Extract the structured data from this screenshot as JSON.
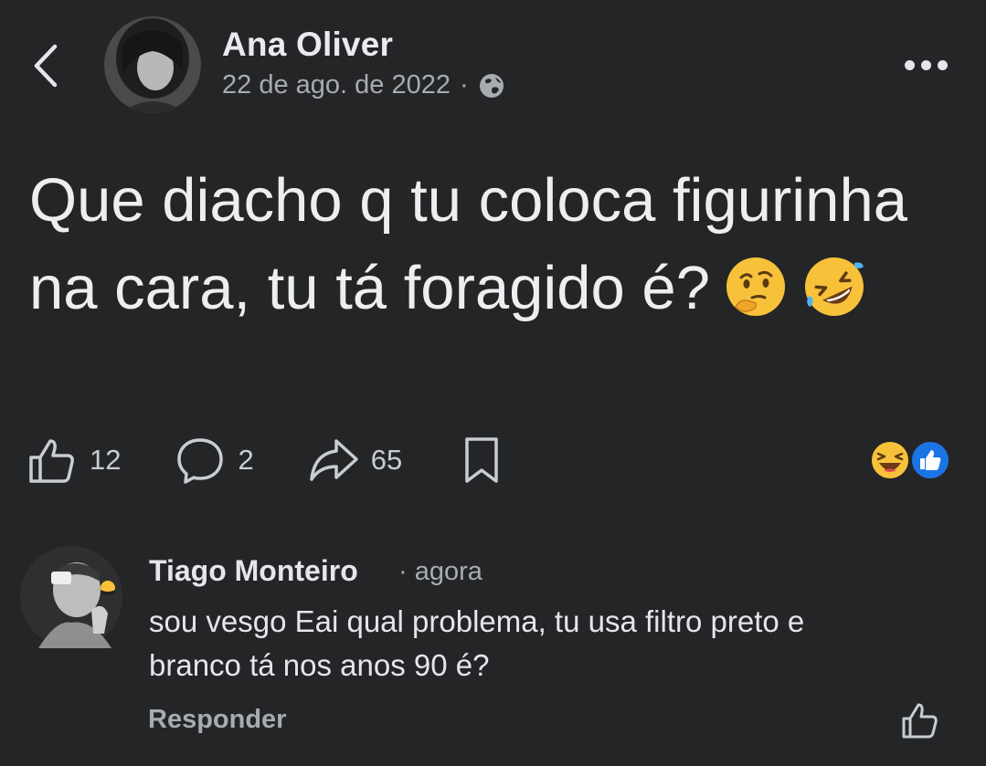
{
  "post": {
    "author_name": "Ana Oliver",
    "date": "22 de ago. de 2022",
    "meta_separator": "·",
    "text": "Que diacho q tu coloca figurinha na cara, tu tá foragido é?",
    "emojis": [
      "thinking-face",
      "rolling-on-floor-laughing"
    ],
    "likes_count": "12",
    "comments_count": "2",
    "shares_count": "65",
    "reactions": [
      "haha",
      "like"
    ]
  },
  "comment": {
    "author_name": "Tiago Monteiro",
    "time": "· agora",
    "text": "sou vesgo Eai qual problema, tu usa filtro preto e branco tá nos anos 90 é?",
    "reply_label": "Responder"
  },
  "icons": {
    "back": "chevron-left-icon",
    "more": "ellipsis-icon",
    "privacy": "globe-icon",
    "like": "thumbs-up-icon",
    "comment": "speech-bubble-icon",
    "share": "share-arrow-icon",
    "save": "bookmark-icon"
  },
  "colors": {
    "background": "#242526",
    "text_primary": "#e4e6eb",
    "text_secondary": "#a8abaf",
    "like_blue": "#1b74e4",
    "haha_yellow": "#f7c23a"
  }
}
